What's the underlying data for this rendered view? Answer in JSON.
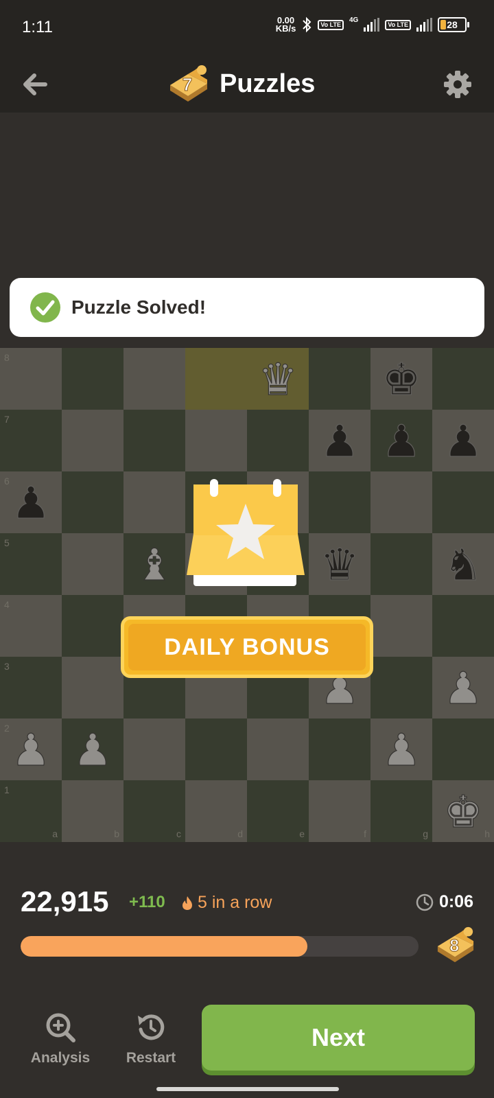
{
  "status_bar": {
    "time": "1:11",
    "net_rate_value": "0.00",
    "net_rate_unit": "KB/s",
    "volte_label_1": "Vo LTE",
    "network_type": "4G",
    "volte_label_2": "Vo LTE",
    "battery": "28"
  },
  "header": {
    "title": "Puzzles",
    "puzzle_number": "7",
    "back_icon": "arrow-left-icon",
    "settings_icon": "gear-icon"
  },
  "toast": {
    "message": "Puzzle Solved!",
    "icon": "check-circle-icon"
  },
  "board": {
    "ranks": [
      "8",
      "7",
      "6",
      "5",
      "4",
      "3",
      "2",
      "1"
    ],
    "files": [
      "a",
      "b",
      "c",
      "d",
      "e",
      "f",
      "g",
      "h"
    ],
    "highlight": [
      "d8",
      "e8"
    ],
    "pieces": [
      {
        "square": "e8",
        "piece": "white-queen"
      },
      {
        "square": "g8",
        "piece": "black-king"
      },
      {
        "square": "f7",
        "piece": "black-pawn"
      },
      {
        "square": "g7",
        "piece": "black-pawn"
      },
      {
        "square": "h7",
        "piece": "black-pawn"
      },
      {
        "square": "a6",
        "piece": "black-pawn"
      },
      {
        "square": "c5",
        "piece": "white-bishop"
      },
      {
        "square": "f5",
        "piece": "black-queen"
      },
      {
        "square": "h5",
        "piece": "black-knight"
      },
      {
        "square": "f3",
        "piece": "white-pawn"
      },
      {
        "square": "h3",
        "piece": "white-pawn"
      },
      {
        "square": "a2",
        "piece": "white-pawn"
      },
      {
        "square": "b2",
        "piece": "white-pawn"
      },
      {
        "square": "g2",
        "piece": "white-pawn"
      },
      {
        "square": "h1",
        "piece": "white-king"
      }
    ]
  },
  "bonus": {
    "label": "DAILY BONUS",
    "icon": "calendar-star-icon"
  },
  "stats": {
    "score": "22,915",
    "delta": "+110",
    "streak": "5 in a row",
    "timer": "0:06",
    "progress_fraction": 0.72,
    "next_puzzle_number": "8"
  },
  "actions": {
    "analysis_label": "Analysis",
    "restart_label": "Restart",
    "next_label": "Next"
  },
  "colors": {
    "light_square": "#5f5c54",
    "dark_square": "#3c4234",
    "accent_green": "#81b64c",
    "bonus_gold": "#f5b928",
    "progress_orange": "#f9a45c"
  }
}
